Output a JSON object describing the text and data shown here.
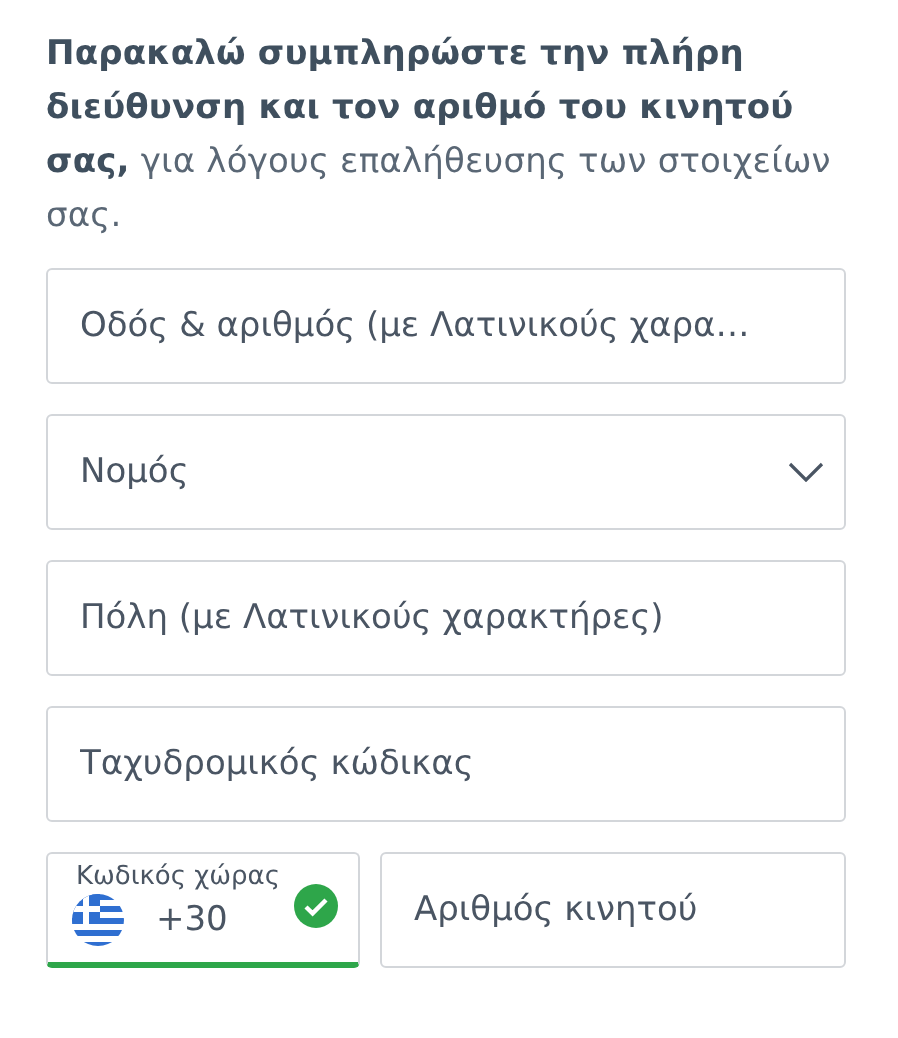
{
  "intro": "**Παρακαλώ συμπληρώστε την πλήρη διεύθυνση και τον αριθμό του κινητού σας,** για λόγους επαλήθευσης των στοιχείων σας.",
  "fields": [
    {
      "kind": "text",
      "placeholder": "Οδός & αριθμός (με Λατινικούς χαρα…"
    },
    {
      "kind": "select",
      "placeholder": "Νομός"
    },
    {
      "kind": "text",
      "placeholder": "Πόλη (με Λατινικούς χαρακτήρες)"
    },
    {
      "kind": "text",
      "placeholder": "Ταχυδρομικός κώδικας"
    }
  ],
  "phone": {
    "country_code": {
      "label": "Κωδικός χώρας",
      "value": "+30",
      "valid": true
    },
    "number": {
      "placeholder": "Αριθμός κινητού"
    }
  }
}
